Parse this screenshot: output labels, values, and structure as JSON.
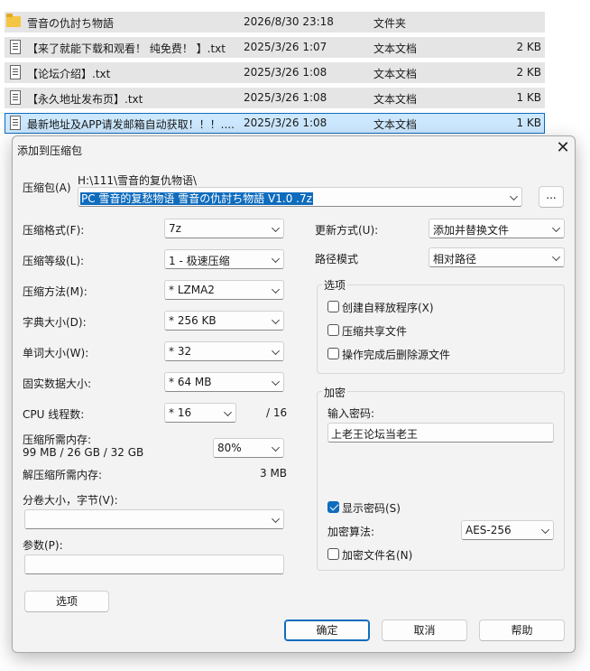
{
  "files": [
    {
      "name": "雪音の仇討ち物語",
      "date": "2026/8/30 23:18",
      "type": "文件夹",
      "size": "",
      "icon": "folder-icon"
    },
    {
      "name": "【来了就能下载和观看！ 纯免费！ 】.txt",
      "date": "2025/3/26 1:07",
      "type": "文本文档",
      "size": "2 KB",
      "icon": "text-file-icon"
    },
    {
      "name": "【论坛介绍】.txt",
      "date": "2025/3/26 1:08",
      "type": "文本文档",
      "size": "2 KB",
      "icon": "text-file-icon"
    },
    {
      "name": "【永久地址发布页】.txt",
      "date": "2025/3/26 1:08",
      "type": "文本文档",
      "size": "1 KB",
      "icon": "text-file-icon"
    },
    {
      "name": "最新地址及APP请发邮箱自动获取！！！....",
      "date": "2025/3/26 1:08",
      "type": "文本文档",
      "size": "1 KB",
      "icon": "text-file-icon"
    }
  ],
  "dialog": {
    "title": "添加到压缩包",
    "archive_label": "压缩包(A)",
    "archive_path": "H:\\111\\雪音的复仇物语\\",
    "archive_name": "PC 雪音的复愁物语 雪音の仇討ち物語 V1.0 .7z",
    "browse_label": "...",
    "format_label": "压缩格式(F):",
    "format_value": "7z",
    "level_label": "压缩等级(L):",
    "level_value": "1 - 极速压缩",
    "method_label": "压缩方法(M):",
    "method_value": "* LZMA2",
    "dict_label": "字典大小(D):",
    "dict_value": "* 256 KB",
    "word_label": "单词大小(W):",
    "word_value": "* 32",
    "solid_label": "固实数据大小:",
    "solid_value": "* 64 MB",
    "cpu_label": "CPU 线程数:",
    "cpu_value": "* 16",
    "cpu_total": "/ 16",
    "mem_label": "压缩所需内存:",
    "mem_detail": "99 MB / 26 GB / 32 GB",
    "mem_value": "80%",
    "decomp_label": "解压缩所需内存:",
    "decomp_value": "3 MB",
    "volume_label": "分卷大小，字节(V):",
    "volume_value": "",
    "params_label": "参数(P):",
    "params_value": "",
    "options_btn": "选项",
    "update_label": "更新方式(U):",
    "update_value": "添加并替换文件",
    "pathmode_label": "路径模式",
    "pathmode_value": "相对路径",
    "options_group": "选项",
    "opt_sfx": "创建自释放程序(X)",
    "opt_shared": "压缩共享文件",
    "opt_delete": "操作完成后删除源文件",
    "enc_group": "加密",
    "pwd_label": "输入密码:",
    "pwd_value": "上老王论坛当老王",
    "show_pwd": "显示密码(S)",
    "enc_method_label": "加密算法:",
    "enc_method_value": "AES-256",
    "enc_names": "加密文件名(N)",
    "ok": "确定",
    "cancel": "取消",
    "help": "帮助"
  },
  "colors": {
    "accent": "#0f6cbd",
    "selection_bg": "#cce8ff",
    "row_bg": "#e5e5e5",
    "dialog_bg": "#f3f3f3"
  }
}
